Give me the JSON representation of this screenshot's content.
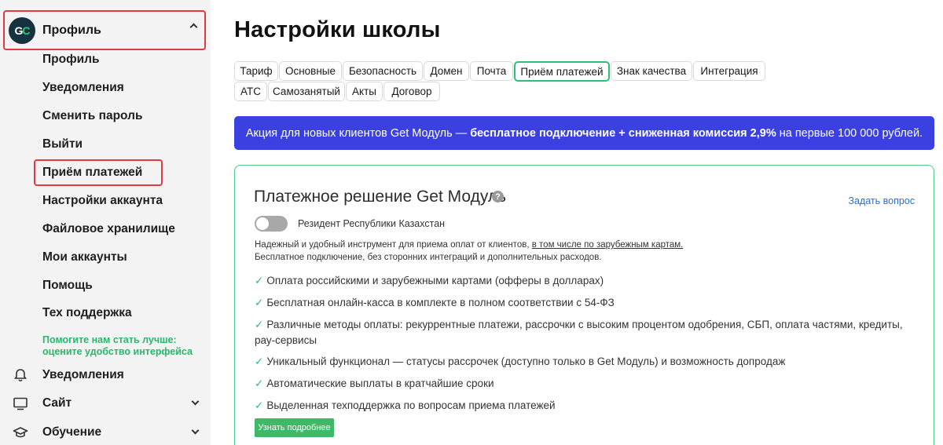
{
  "sidebar": {
    "logo_text_a": "G",
    "logo_text_b": "C",
    "profile_title": "Профиль",
    "sub_items": [
      "Профиль",
      "Уведомления",
      "Сменить пароль",
      "Выйти",
      "Приём платежей",
      "Настройки аккаунта",
      "Файловое хранилище",
      "Мои аккаунты",
      "Помощь",
      "Тех поддержка"
    ],
    "feedback_line1": "Помогите нам стать лучше:",
    "feedback_line2": "оцените удобство интерфейса",
    "main_items": [
      {
        "label": "Уведомления",
        "icon": "bell-icon"
      },
      {
        "label": "Сайт",
        "icon": "monitor-icon"
      },
      {
        "label": "Обучение",
        "icon": "graduation-cap-icon"
      }
    ]
  },
  "page": {
    "title": "Настройки школы"
  },
  "tabs": [
    "Тариф",
    "Основные",
    "Безопасность",
    "Домен",
    "Почта",
    "Приём платежей",
    "Знак качества",
    "Интеграция",
    "АТС",
    "Самозанятый",
    "Акты",
    "Договор"
  ],
  "active_tab": "Приём платежей",
  "promo": {
    "prefix": "Акция для новых клиентов Get Модуль —",
    "bold": "бесплатное подключение + сниженная комиссия 2,9%",
    "suffix": "на первые 100 000 рублей."
  },
  "card": {
    "title": "Платежное решение Get Модуль",
    "help_glyph": "?",
    "ask_link": "Задать вопрос",
    "toggle_label": "Резидент Республики Казахстан",
    "toggle_on": false,
    "desc_line1_prefix": "Надежный и удобный инструмент для приема оплат от клиентов,",
    "desc_line1_link": "в том числе по зарубежным картам.",
    "desc_line2": "Бесплатное подключение, без сторонних интеграций и дополнительных расходов.",
    "check_glyph": "✓",
    "features": [
      "Оплата российскими и зарубежными картами (офферы в долларах)",
      "Бесплатная онлайн-касса в комплекте в полном соответствии с 54-ФЗ",
      "Различные методы оплаты: рекуррентные платежи, рассрочки с высоким процентом одобрения, СБП, оплата частями, кредиты, рау-сервисы",
      "Уникальный функционал — статусы рассрочек (доступно только в Get Модуль) и возможность допродаж",
      "Автоматические выплаты в кратчайшие сроки",
      "Выделенная техподдержка по вопросам приема платежей"
    ],
    "more_button": "Узнать подробнее"
  },
  "colors": {
    "accent_green": "#2fbf73",
    "promo_blue": "#3b41e0",
    "highlight_red": "#e0393e",
    "link_blue": "#2a6fd6"
  }
}
